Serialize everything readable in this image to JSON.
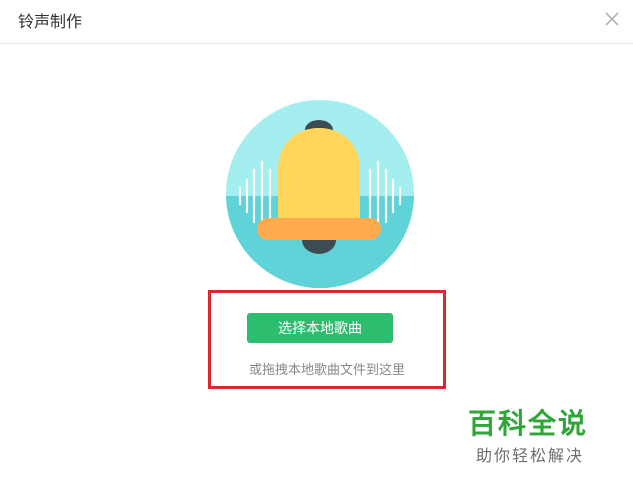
{
  "window": {
    "title": "铃声制作"
  },
  "main": {
    "select_button_label": "选择本地歌曲",
    "drop_hint": "或拖拽本地歌曲文件到这里"
  },
  "watermark": {
    "title": "百科全说",
    "subtitle": "助你轻松解决"
  },
  "icons": {
    "close": "close-icon",
    "hero": "bell-icon"
  },
  "colors": {
    "accent_green": "#2dbd6e",
    "highlight_red": "#d72b2b",
    "bell_yellow": "#ffd55a",
    "bell_orange": "#ffaa4f",
    "circle_teal": "#5fd3d8"
  }
}
